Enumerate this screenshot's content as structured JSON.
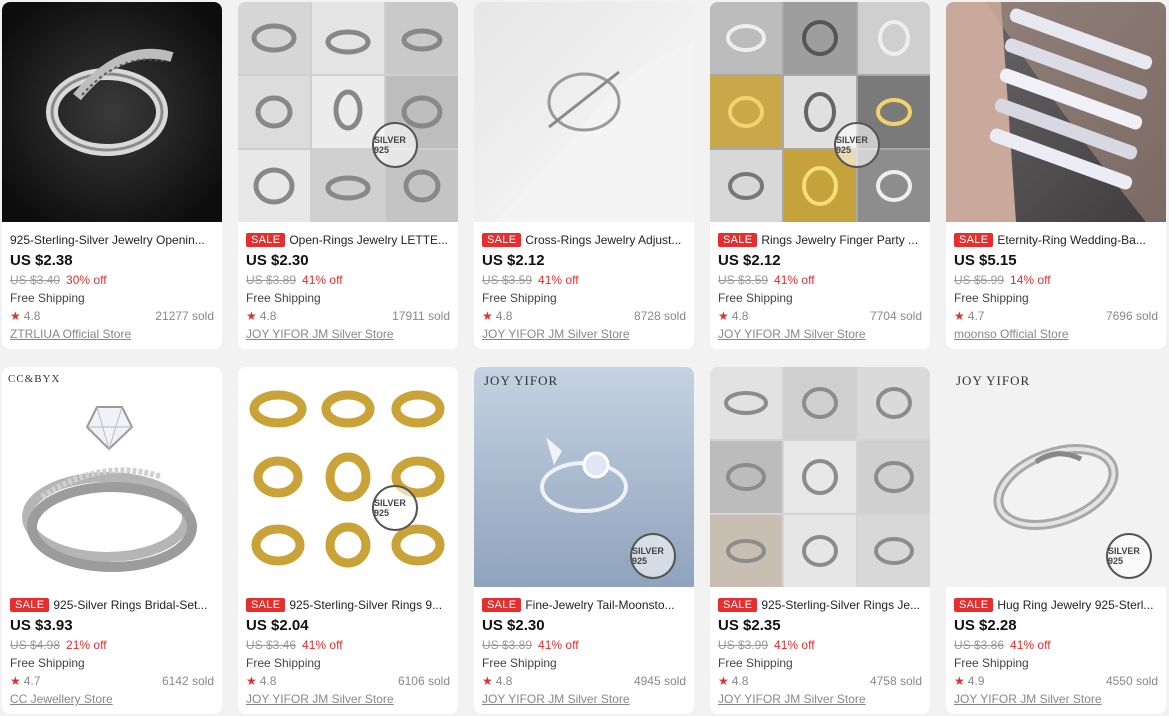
{
  "products": [
    {
      "sale": "",
      "title": "925-Sterling-Silver Jewelry Openin...",
      "price": "US $2.38",
      "original": "US $3.40",
      "discount": "30% off",
      "shipping": "Free Shipping",
      "rating": "4.8",
      "sold": "21277 sold",
      "store": "ZTRLIUA Official Store"
    },
    {
      "sale": "SALE",
      "title": "Open-Rings Jewelry LETTE...",
      "price": "US $2.30",
      "original": "US $3.89",
      "discount": "41% off",
      "shipping": "Free Shipping",
      "rating": "4.8",
      "sold": "17911 sold",
      "store": "JOY YIFOR JM Silver Store"
    },
    {
      "sale": "SALE",
      "title": "Cross-Rings Jewelry Adjust...",
      "price": "US $2.12",
      "original": "US $3.59",
      "discount": "41% off",
      "shipping": "Free Shipping",
      "rating": "4.8",
      "sold": "8728 sold",
      "store": "JOY YIFOR JM Silver Store"
    },
    {
      "sale": "SALE",
      "title": "Rings Jewelry Finger Party ...",
      "price": "US $2.12",
      "original": "US $3.59",
      "discount": "41% off",
      "shipping": "Free Shipping",
      "rating": "4.8",
      "sold": "7704 sold",
      "store": "JOY YIFOR JM Silver Store"
    },
    {
      "sale": "SALE",
      "title": "Eternity-Ring Wedding-Ba...",
      "price": "US $5.15",
      "original": "US $5.99",
      "discount": "14% off",
      "shipping": "Free Shipping",
      "rating": "4.7",
      "sold": "7696 sold",
      "store": "moonso Official Store"
    },
    {
      "sale": "SALE",
      "title": "925-Silver Rings Bridal-Set...",
      "price": "US $3.93",
      "original": "US $4.98",
      "discount": "21% off",
      "shipping": "Free Shipping",
      "rating": "4.7",
      "sold": "6142 sold",
      "store": "CC Jewellery Store"
    },
    {
      "sale": "SALE",
      "title": "925-Sterling-Silver Rings 9...",
      "price": "US $2.04",
      "original": "US $3.46",
      "discount": "41% off",
      "shipping": "Free Shipping",
      "rating": "4.8",
      "sold": "6106 sold",
      "store": "JOY YIFOR JM Silver Store"
    },
    {
      "sale": "SALE",
      "title": "Fine-Jewelry Tail-Moonsto...",
      "price": "US $2.30",
      "original": "US $3.89",
      "discount": "41% off",
      "shipping": "Free Shipping",
      "rating": "4.8",
      "sold": "4945 sold",
      "store": "JOY YIFOR JM Silver Store"
    },
    {
      "sale": "SALE",
      "title": "925-Sterling-Silver Rings Je...",
      "price": "US $2.35",
      "original": "US $3.99",
      "discount": "41% off",
      "shipping": "Free Shipping",
      "rating": "4.8",
      "sold": "4758 sold",
      "store": "JOY YIFOR JM Silver Store"
    },
    {
      "sale": "SALE",
      "title": "Hug Ring Jewelry 925-Sterl...",
      "price": "US $2.28",
      "original": "US $3.86",
      "discount": "41% off",
      "shipping": "Free Shipping",
      "rating": "4.9",
      "sold": "4550 sold",
      "store": "JOY YIFOR JM Silver Store"
    }
  ],
  "image_text": {
    "brand_joy": "JOY YIFOR",
    "brand_cc": "CC&BYX",
    "stamp_silver": "SILVER 925"
  },
  "colors": {
    "sale_red": "#e62e2e",
    "star": "#e62e2e"
  }
}
